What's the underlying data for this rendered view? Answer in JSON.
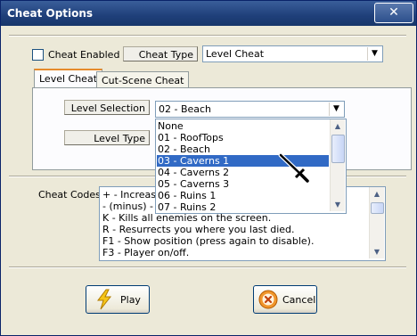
{
  "window": {
    "title": "Cheat Options",
    "close_glyph": "✕"
  },
  "cheat_enabled": {
    "label": "Cheat Enabled",
    "checked": false
  },
  "cheat_type": {
    "label": "Cheat Type",
    "value": "Level Cheat"
  },
  "tabs": [
    {
      "label": "Level Cheat"
    },
    {
      "label": "Cut-Scene Cheat"
    }
  ],
  "level_selection": {
    "label": "Level Selection",
    "value": "02 - Beach",
    "options": [
      "None",
      "01 - RoofTops",
      "02 - Beach",
      "03 - Caverns 1",
      "04 - Caverns 2",
      "05 - Caverns 3",
      "06 - Ruins 1",
      "07 - Ruins 2"
    ],
    "highlighted": "03 - Caverns 1"
  },
  "level_type": {
    "label": "Level Type"
  },
  "cheat_codes": {
    "label": "Cheat Codes",
    "lines": [
      "+ - Increase",
      "- (minus) - D",
      "K - Kills all enemies on the screen.",
      "R - Resurrects you where you last died.",
      "F1 - Show position (press again to disable).",
      "F3 - Player on/off."
    ]
  },
  "buttons": {
    "play": "Play",
    "cancel": "Cancel"
  },
  "colors": {
    "title_bar": "#1f3f7a",
    "selection": "#316ac5",
    "tab_accent": "#e68b2c"
  }
}
